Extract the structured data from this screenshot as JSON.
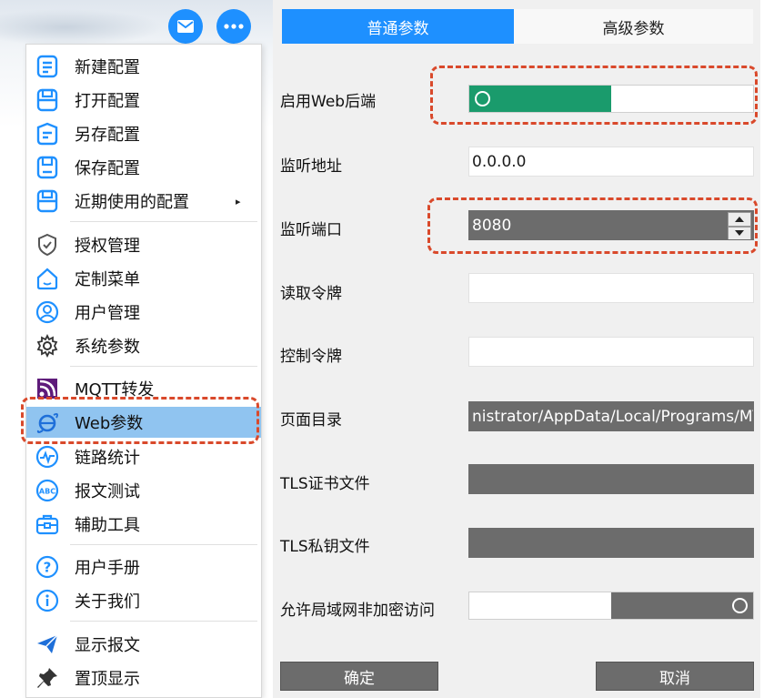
{
  "menu": {
    "items": [
      {
        "label": "新建配置",
        "icon": "new-config-icon"
      },
      {
        "label": "打开配置",
        "icon": "open-config-icon"
      },
      {
        "label": "另存配置",
        "icon": "save-as-icon"
      },
      {
        "label": "保存配置",
        "icon": "save-icon"
      },
      {
        "label": "近期使用的配置",
        "icon": "recent-config-icon",
        "submenu": "▸"
      },
      {
        "label": "授权管理",
        "icon": "shield-icon"
      },
      {
        "label": "定制菜单",
        "icon": "home-icon"
      },
      {
        "label": "用户管理",
        "icon": "user-icon"
      },
      {
        "label": "系统参数",
        "icon": "gear-icon"
      },
      {
        "label": "MQTT转发",
        "icon": "rss-icon"
      },
      {
        "label": "Web参数",
        "icon": "web-icon"
      },
      {
        "label": "链路统计",
        "icon": "pulse-icon"
      },
      {
        "label": "报文测试",
        "icon": "abc-icon"
      },
      {
        "label": "辅助工具",
        "icon": "toolbox-icon"
      },
      {
        "label": "用户手册",
        "icon": "help-icon"
      },
      {
        "label": "关于我们",
        "icon": "info-icon"
      },
      {
        "label": "显示报文",
        "icon": "send-icon"
      },
      {
        "label": "置顶显示",
        "icon": "pin-icon"
      }
    ]
  },
  "tabs": {
    "general": "普通参数",
    "advanced": "高级参数"
  },
  "form": {
    "enable_web_label": "启用Web后端",
    "listen_addr_label": "监听地址",
    "listen_addr_value": "0.0.0.0",
    "listen_port_label": "监听端口",
    "listen_port_value": "8080",
    "read_token_label": "读取令牌",
    "read_token_value": "",
    "control_token_label": "控制令牌",
    "control_token_value": "",
    "page_dir_label": "页面目录",
    "page_dir_value": "nistrator/AppData/Local/Programs/MT",
    "tls_cert_label": "TLS证书文件",
    "tls_key_label": "TLS私钥文件",
    "allow_lan_label": "允许局域网非加密访问"
  },
  "buttons": {
    "ok": "确定",
    "cancel": "取消"
  },
  "colors": {
    "accent": "#1e90ff",
    "toggle_on": "#1a9b6c",
    "toggle_off": "#6c6c6c",
    "highlight": "#90c4f0",
    "annotation": "#d9492b"
  }
}
